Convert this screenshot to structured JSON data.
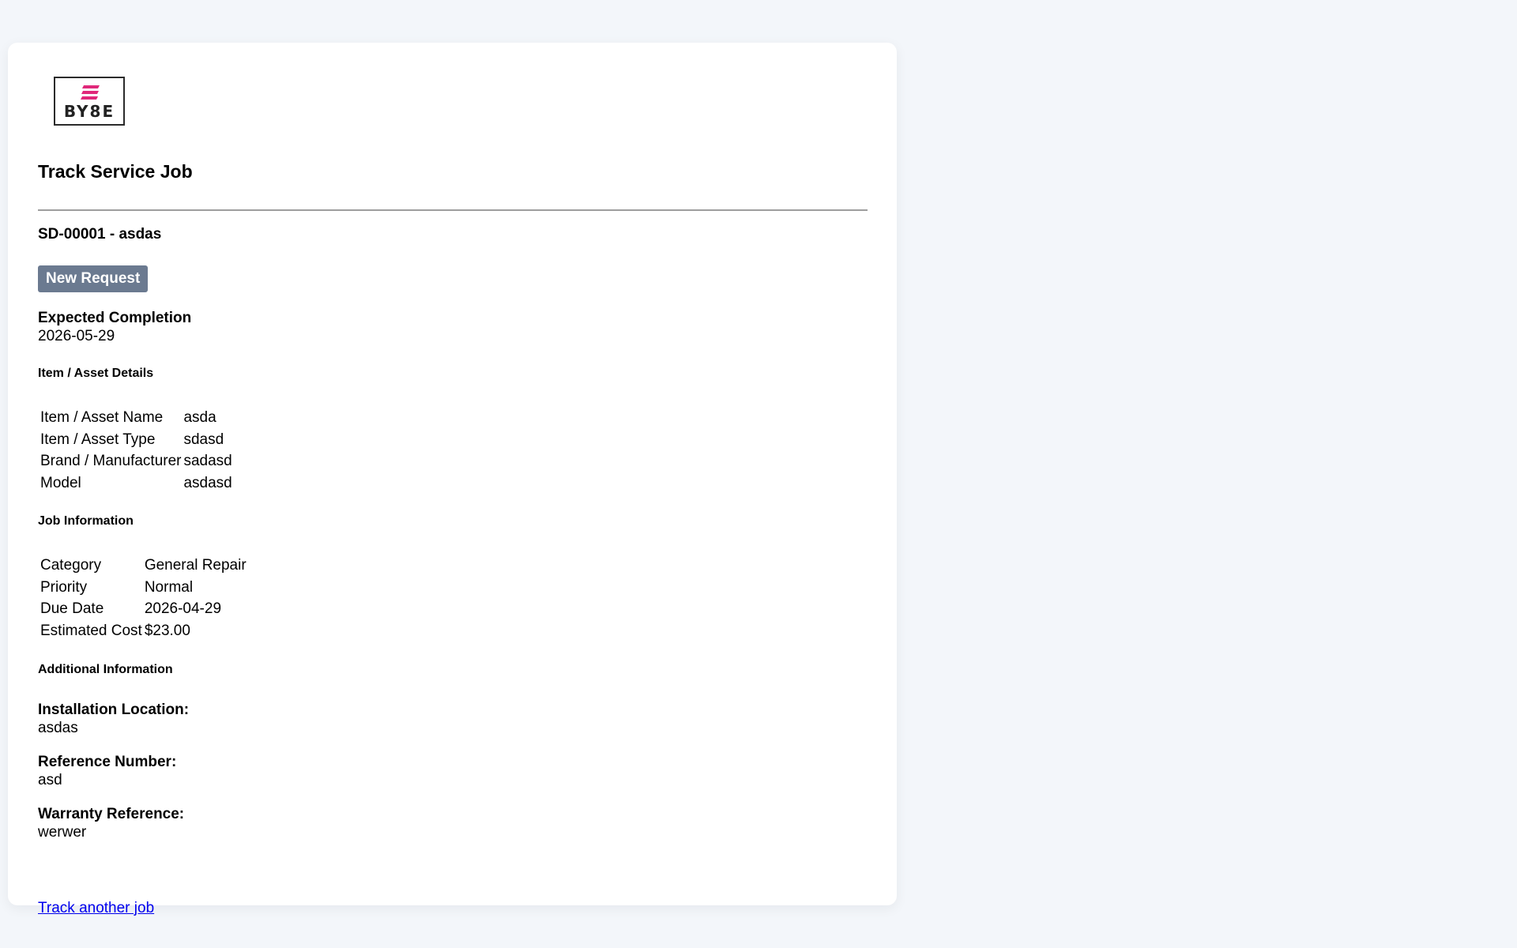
{
  "logo": {
    "text": "BY8E",
    "mark_color": "#e0287a"
  },
  "page": {
    "title": "Track Service Job"
  },
  "job": {
    "id_title": "SD-00001 - asdas",
    "status": "New Request",
    "status_color": "#6b7a90",
    "expected_completion_label": "Expected Completion",
    "expected_completion_value": "2026-05-29"
  },
  "asset_details": {
    "heading": "Item / Asset Details",
    "rows": [
      {
        "label": "Item / Asset Name",
        "value": "asda"
      },
      {
        "label": "Item / Asset Type",
        "value": "sdasd"
      },
      {
        "label": "Brand / Manufacturer",
        "value": "sadasd"
      },
      {
        "label": "Model",
        "value": "asdasd"
      }
    ]
  },
  "job_information": {
    "heading": "Job Information",
    "rows": [
      {
        "label": "Category",
        "value": "General Repair"
      },
      {
        "label": "Priority",
        "value": "Normal"
      },
      {
        "label": "Due Date",
        "value": "2026-04-29"
      },
      {
        "label": "Estimated Cost",
        "value": "$23.00"
      }
    ]
  },
  "additional_information": {
    "heading": "Additional Information",
    "installation_location_label": "Installation Location:",
    "installation_location_value": "asdas",
    "reference_number_label": "Reference Number:",
    "reference_number_value": "asd",
    "warranty_reference_label": "Warranty Reference:",
    "warranty_reference_value": "werwer"
  },
  "actions": {
    "track_another_label": "Track another job"
  }
}
